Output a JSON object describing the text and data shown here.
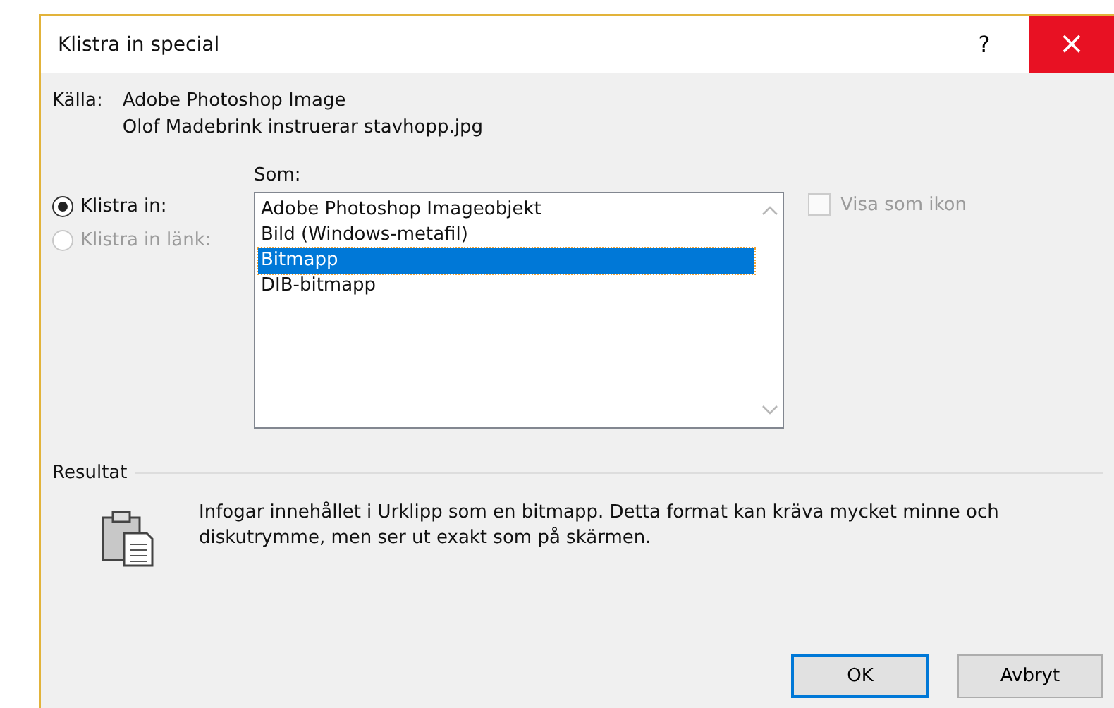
{
  "window": {
    "title": "Klistra in special",
    "help": "?",
    "close": "×"
  },
  "source": {
    "label": "Källa:",
    "lines": [
      "Adobe Photoshop Image",
      "Olof Madebrink instruerar stavhopp.jpg"
    ]
  },
  "paste_options": [
    {
      "label": "Klistra in:",
      "selected": true,
      "disabled": false
    },
    {
      "label": "Klistra in länk:",
      "selected": false,
      "disabled": true
    }
  ],
  "as_list": {
    "label": "Som:",
    "items": [
      {
        "label": "Adobe Photoshop Imageobjekt",
        "selected": false
      },
      {
        "label": "Bild (Windows-metafil)",
        "selected": false
      },
      {
        "label": "Bitmapp",
        "selected": true
      },
      {
        "label": "DIB-bitmapp",
        "selected": false
      }
    ]
  },
  "show_as_icon": {
    "label": "Visa som ikon",
    "checked": false,
    "disabled": true
  },
  "result": {
    "label": "Resultat",
    "text": "Infogar innehållet i Urklipp som en bitmapp. Detta format kan kräva mycket minne och diskutrymme, men ser ut exakt som på skärmen."
  },
  "buttons": [
    {
      "label": "OK",
      "default": true
    },
    {
      "label": "Avbryt",
      "default": false
    }
  ]
}
